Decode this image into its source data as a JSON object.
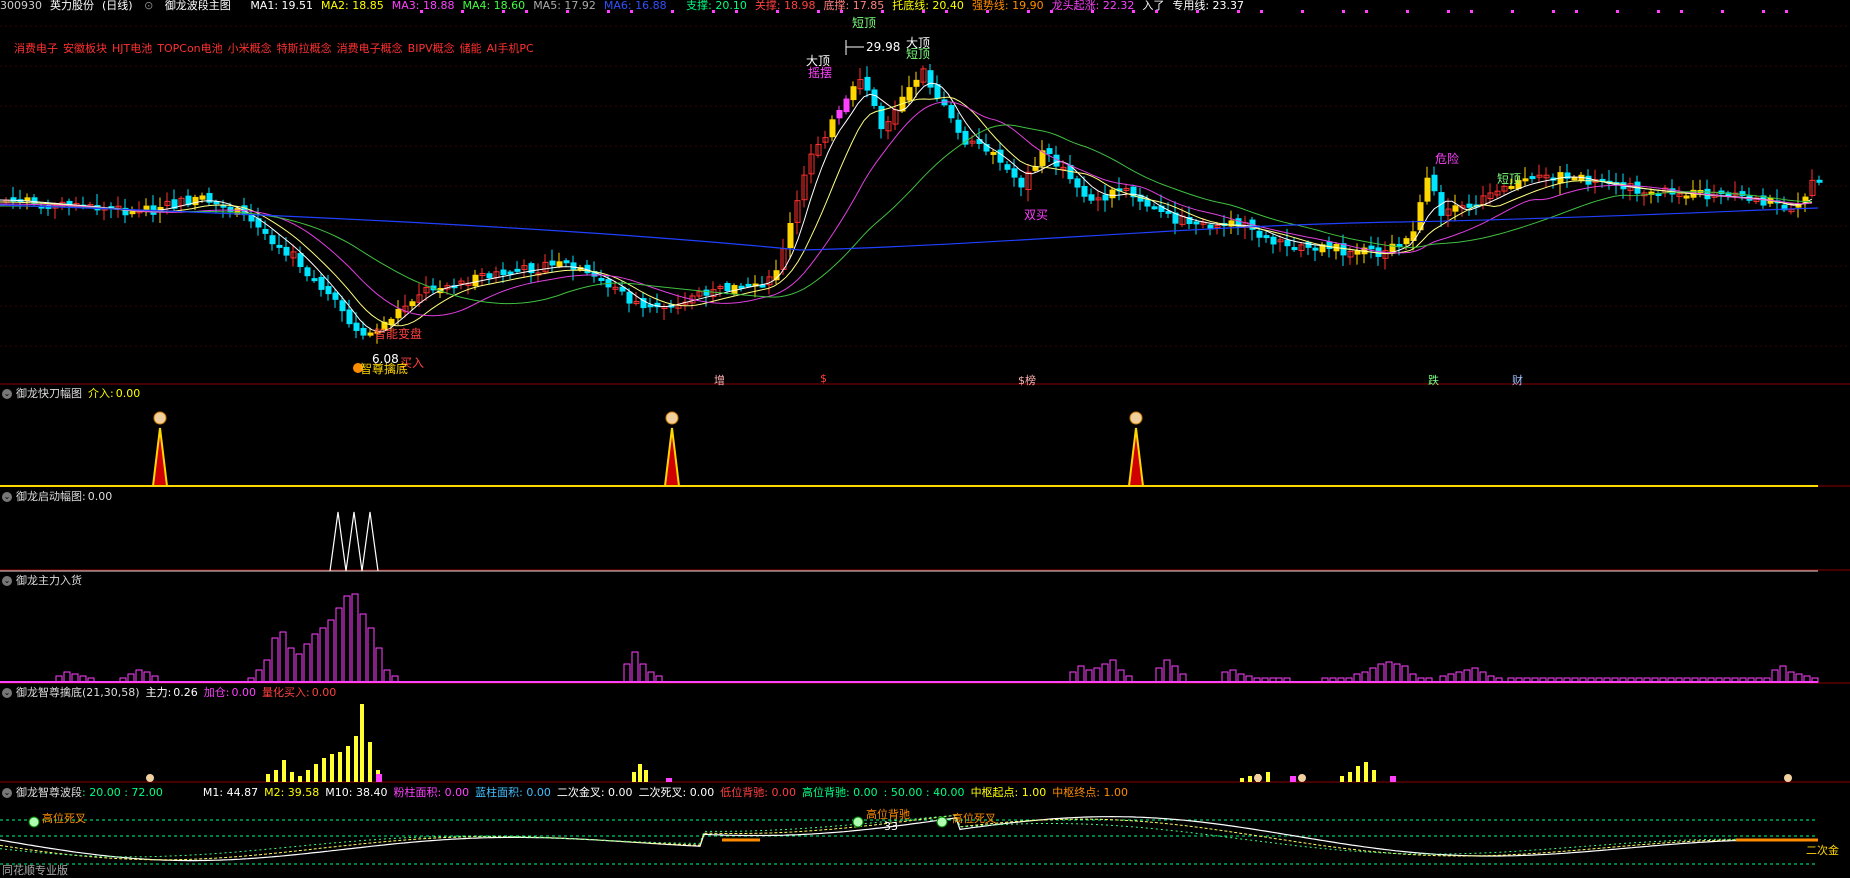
{
  "header": {
    "code": "300930",
    "name": "英力股份",
    "period": "(日线)",
    "indicator": "御龙波段主图",
    "ma": [
      {
        "label": "MA1:",
        "value": "19.51",
        "color": "#ffffff"
      },
      {
        "label": "MA2:",
        "value": "18.85",
        "color": "#ffff00"
      },
      {
        "label": "MA3:",
        "value": "18.88",
        "color": "#ff40ff"
      },
      {
        "label": "MA4:",
        "value": "18.60",
        "color": "#40ff40"
      },
      {
        "label": "MA5:",
        "value": "17.92",
        "color": "#aaaaaa"
      },
      {
        "label": "MA6:",
        "value": "16.88",
        "color": "#3050ff"
      }
    ],
    "levels": [
      {
        "label": "支撑:",
        "value": "20.10",
        "color": "#00ff80"
      },
      {
        "label": "关撑:",
        "value": "18.98",
        "color": "#ff4040"
      },
      {
        "label": "底撑:",
        "value": "17.85",
        "color": "#ff8080"
      },
      {
        "label": "托底线:",
        "value": "20.40",
        "color": "#ffff00"
      },
      {
        "label": "强势线:",
        "value": "19.90",
        "color": "#ff8c00"
      },
      {
        "label": "龙头起涨:",
        "value": "22.32",
        "color": "#ff40ff"
      },
      {
        "label": "入了",
        "value": "",
        "color": "#ffffff"
      },
      {
        "label": "专用线:",
        "value": "23.37",
        "color": "#ffffff"
      }
    ]
  },
  "concepts": [
    "消费电子",
    "安徽板块",
    "HJT电池",
    "TOPCon电池",
    "小米概念",
    "特斯拉概念",
    "消费电子概念",
    "BIPV概念",
    "储能",
    "AI手机PC"
  ],
  "main_annotations": {
    "dading1": "大顶",
    "price_high": "29.98",
    "duanding1": "短顶",
    "dading2": "大顶",
    "duanding2": "短顶",
    "duanding3": "短顶",
    "yaolian": "摇摆",
    "weixian": "危险",
    "duanding4": "短顶",
    "shuangmai": "双买",
    "zhinengbiangqu": "智能变盘",
    "price_low": "6.08",
    "mairu": "买入",
    "zhizunqinddi": "智尊擒底"
  },
  "events": [
    {
      "text": "增",
      "color": "#ffb0b0"
    },
    {
      "text": "$",
      "color": "#ff4040"
    },
    {
      "text": "$榜",
      "color": "#ffb0b0"
    },
    {
      "text": "跌",
      "color": "#80ff80"
    },
    {
      "text": "财",
      "color": "#a0c0ff"
    }
  ],
  "panels": {
    "p1": {
      "title": "御龙快刀幅图",
      "label": "介入:",
      "value": "0.00"
    },
    "p2": {
      "title": "御龙启动幅图",
      "label": ":",
      "value": "0.00"
    },
    "p3": {
      "title": "御龙主力入货"
    },
    "p4": {
      "title": "御龙智尊擒底(21,30,58)",
      "zhuli_label": "主力:",
      "zhuli": "0.26",
      "jiacang_label": "加仓:",
      "jiacang": "0.00",
      "lianghua_label": "量化买入:",
      "lianghua": "0.00"
    },
    "p5": {
      "title": "御龙智尊波段",
      "range": ": 20.00 : 72.00",
      "items": [
        {
          "text": "M1: 44.87",
          "color": "#ffffff"
        },
        {
          "text": "M2: 39.58",
          "color": "#ffff00"
        },
        {
          "text": "M10: 38.40",
          "color": "#ffffff"
        },
        {
          "text": "粉柱面积: 0.00",
          "color": "#ff40ff"
        },
        {
          "text": "蓝柱面积: 0.00",
          "color": "#40c0ff"
        },
        {
          "text": "二次金叉: 0.00",
          "color": "#ffffff"
        },
        {
          "text": "二次死叉: 0.00",
          "color": "#ffffff"
        },
        {
          "text": "低位背驰: 0.00",
          "color": "#ff4040"
        },
        {
          "text": "高位背驰: 0.00",
          "color": "#00ff80"
        },
        {
          "text": ": 50.00 : 40.00",
          "color": "#00ff80"
        },
        {
          "text": "中枢起点: 1.00",
          "color": "#ffff00"
        },
        {
          "text": "中枢终点: 1.00",
          "color": "#ff8c00"
        }
      ],
      "ann_gaowei": "高位背驰",
      "ann_33": "33",
      "ann_zhi": "高位死叉",
      "ann_zhi2": "高位死叉",
      "ann_erci": "二次金"
    }
  },
  "footer": {
    "text": "同花顺专业版"
  },
  "colors": {
    "up": "#ff3030",
    "down": "#00e5ff",
    "bull": "#ffd700",
    "separator": "#8b0000"
  }
}
